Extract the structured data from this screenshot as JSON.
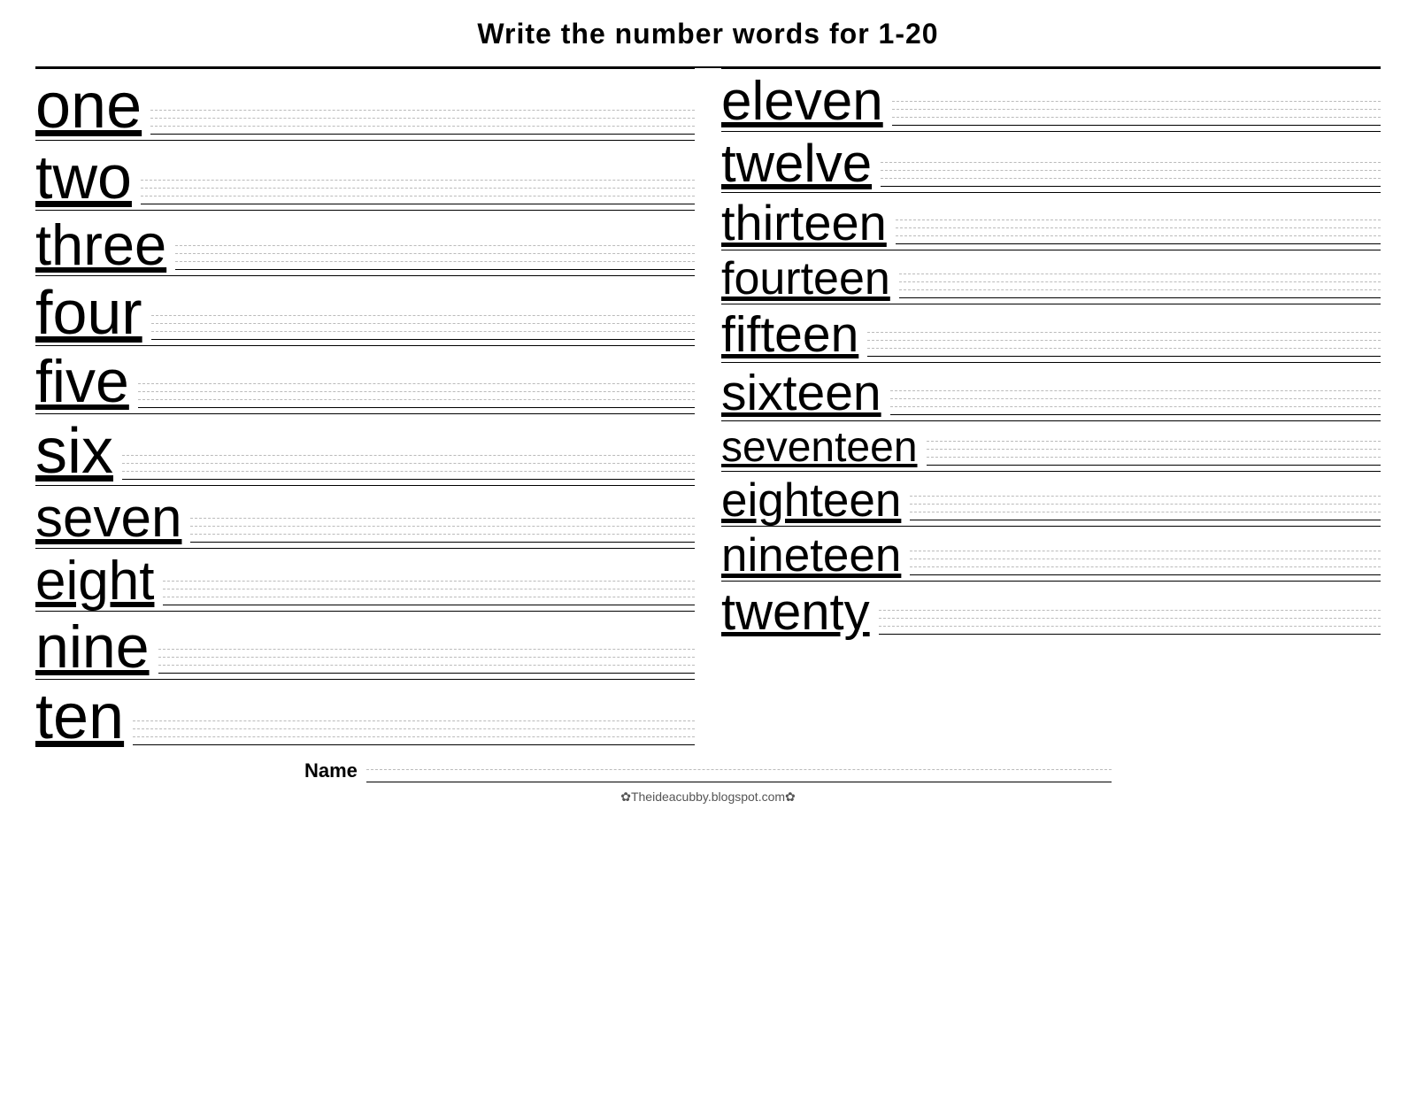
{
  "title": "Write the number words for  1-20",
  "left_numbers": [
    {
      "word": "one",
      "size": "72"
    },
    {
      "word": "two",
      "size": "70"
    },
    {
      "word": "three",
      "size": "65"
    },
    {
      "word": "four",
      "size": "70"
    },
    {
      "word": "five",
      "size": "68"
    },
    {
      "word": "six",
      "size": "72"
    },
    {
      "word": "seven",
      "size": "62"
    },
    {
      "word": "eight",
      "size": "62"
    },
    {
      "word": "nine",
      "size": "68"
    },
    {
      "word": "ten",
      "size": "72"
    }
  ],
  "right_numbers": [
    {
      "word": "eleven",
      "size": "62"
    },
    {
      "word": "twelve",
      "size": "60"
    },
    {
      "word": "thirteen",
      "size": "56"
    },
    {
      "word": "fourteen",
      "size": "52"
    },
    {
      "word": "fifteen",
      "size": "57"
    },
    {
      "word": "sixteen",
      "size": "57"
    },
    {
      "word": "seventeen",
      "size": "48"
    },
    {
      "word": "eighteen",
      "size": "53"
    },
    {
      "word": "nineteen",
      "size": "53"
    },
    {
      "word": "twenty",
      "size": "58"
    }
  ],
  "footer": {
    "name_label": "Name",
    "website": "✿Theideacubby.blogspot.com✿"
  }
}
